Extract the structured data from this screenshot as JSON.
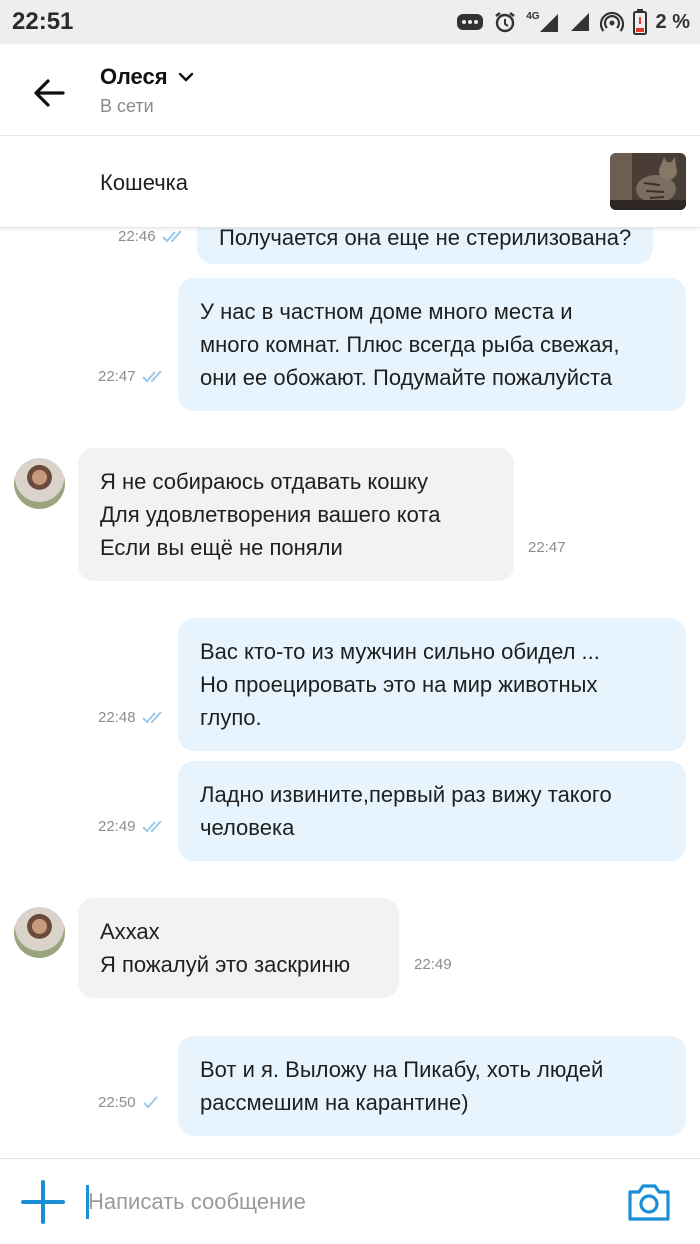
{
  "status_bar": {
    "time": "22:51",
    "network_label": "4G",
    "battery": "2 %",
    "icons": [
      "messages-icon",
      "alarm-icon",
      "signal-4g-icon",
      "signal-icon",
      "hotspot-icon",
      "battery-low-icon"
    ]
  },
  "header": {
    "name": "Олеся",
    "status": "В сети"
  },
  "listing": {
    "title": "Кошечка"
  },
  "messages": [
    {
      "direction": "out",
      "lines": [
        "Получается она еще не стерилизована?"
      ],
      "time": "22:46",
      "read": true
    },
    {
      "direction": "out",
      "lines": [
        "У нас в частном доме много места и",
        "много комнат. Плюс всегда рыба свежая,",
        "они ее обожают. Подумайте пожалуйста"
      ],
      "time": "22:47",
      "read": true
    },
    {
      "direction": "in",
      "lines": [
        "Я не собираюсь отдавать кошку",
        "Для удовлетворения вашего кота",
        "Если вы ещё не поняли"
      ],
      "time": "22:47"
    },
    {
      "direction": "out",
      "lines": [
        "Вас кто-то из мужчин сильно обидел ...",
        "Но проецировать это на мир животных",
        "глупо."
      ],
      "time": "22:48",
      "read": true
    },
    {
      "direction": "out",
      "lines": [
        "Ладно извините,первый раз вижу такого",
        "человека"
      ],
      "time": "22:49",
      "read": true
    },
    {
      "direction": "in",
      "lines": [
        "Аххах",
        "Я пожалуй это заскриню"
      ],
      "time": "22:49"
    },
    {
      "direction": "out",
      "lines": [
        "Вот и я. Выложу на Пикабу, хоть людей",
        "рассмешим на карантине)"
      ],
      "time": "22:50",
      "read": false
    }
  ],
  "input": {
    "placeholder": "Написать сообщение"
  },
  "colors": {
    "accent": "#1b8fd6",
    "outgoing_bubble": "#e7f4fd",
    "incoming_bubble": "#f2f2f2"
  }
}
